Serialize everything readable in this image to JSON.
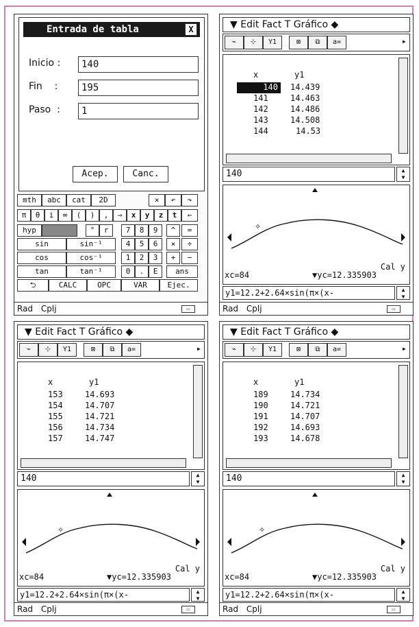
{
  "screens": {
    "top_left": {
      "dialog": {
        "title": "Entrada de tabla",
        "close_glyph": "X",
        "fields": [
          {
            "label": "Inicio :",
            "value": "140"
          },
          {
            "label": "Fin    :",
            "value": "195"
          },
          {
            "label": "Paso  :",
            "value": "1"
          }
        ],
        "accept_label": "Acep.",
        "cancel_label": "Canc."
      },
      "keyboard": {
        "tabs": [
          "mth",
          "abc",
          "cat",
          "2D"
        ],
        "row2": [
          "π",
          "θ",
          "i",
          "∞",
          "(",
          ")",
          ",",
          "⇒",
          "x",
          "y",
          "z",
          "t",
          "←"
        ],
        "row3": [
          "hyp",
          "",
          "°",
          "r",
          "7",
          "8",
          "9",
          "^",
          "="
        ],
        "row4": [
          "sin",
          "sin⁻¹",
          "4",
          "5",
          "6",
          "×",
          "÷"
        ],
        "row5": [
          "cos",
          "cos⁻¹",
          "1",
          "2",
          "3",
          "+",
          "−"
        ],
        "row6": [
          "tan",
          "tan⁻¹",
          "0",
          ".",
          "E",
          "ans"
        ],
        "row7": [
          "⮌",
          "CALC",
          "OPC",
          "VAR",
          "Ejec."
        ]
      },
      "status": {
        "mode": "Rad",
        "complex": "Cplj"
      }
    },
    "top_right": {
      "menu": "▼ Edit Fact T Gráfico ◆",
      "table": {
        "headers": [
          "x",
          "y1"
        ],
        "rows": [
          [
            "140",
            "14.439"
          ],
          [
            "141",
            "14.463"
          ],
          [
            "142",
            "14.486"
          ],
          [
            "143",
            "14.508"
          ],
          [
            "144",
            "14.53"
          ]
        ],
        "selected_row": 0
      },
      "input_value": "140",
      "graph": {
        "xc": "xc=84",
        "yc": "▼yc=12.335903",
        "cal_label": "Cal y"
      },
      "formula": "y1=12.2+2.64×sin(π×(x-",
      "status": {
        "mode": "Rad",
        "complex": "Cplj"
      }
    },
    "bottom_left": {
      "menu": "▼ Edit Fact T Gráfico ◆",
      "table": {
        "headers": [
          "x",
          "y1"
        ],
        "rows": [
          [
            "153",
            "14.693"
          ],
          [
            "154",
            "14.707"
          ],
          [
            "155",
            "14.721"
          ],
          [
            "156",
            "14.734"
          ],
          [
            "157",
            "14.747"
          ]
        ]
      },
      "input_value": "140",
      "graph": {
        "xc": "xc=84",
        "yc": "▼yc=12.335903",
        "cal_label": "Cal y"
      },
      "formula": "y1=12.2+2.64×sin(π×(x-",
      "status": {
        "mode": "Rad",
        "complex": "Cplj"
      }
    },
    "bottom_right": {
      "menu": "▼ Edit Fact T Gráfico ◆",
      "table": {
        "headers": [
          "x",
          "y1"
        ],
        "rows": [
          [
            "189",
            "14.734"
          ],
          [
            "190",
            "14.721"
          ],
          [
            "191",
            "14.707"
          ],
          [
            "192",
            "14.693"
          ],
          [
            "193",
            "14.678"
          ]
        ]
      },
      "input_value": "140",
      "graph": {
        "xc": "xc=84",
        "yc": "▼yc=12.335903",
        "cal_label": "Cal y"
      },
      "formula": "y1=12.2+2.64×sin(π×(x-",
      "status": {
        "mode": "Rad",
        "complex": "Cplj"
      }
    }
  },
  "toolbar_icons": [
    "graph-toggle-icon",
    "trace-icon",
    "y1-y2-icon",
    "zoom-box-icon",
    "zoom-auto-icon",
    "ab-icon"
  ],
  "battery_glyph": "▭",
  "colors": {
    "frame": "#d37db8",
    "title_bg": "#1a1a1a"
  }
}
